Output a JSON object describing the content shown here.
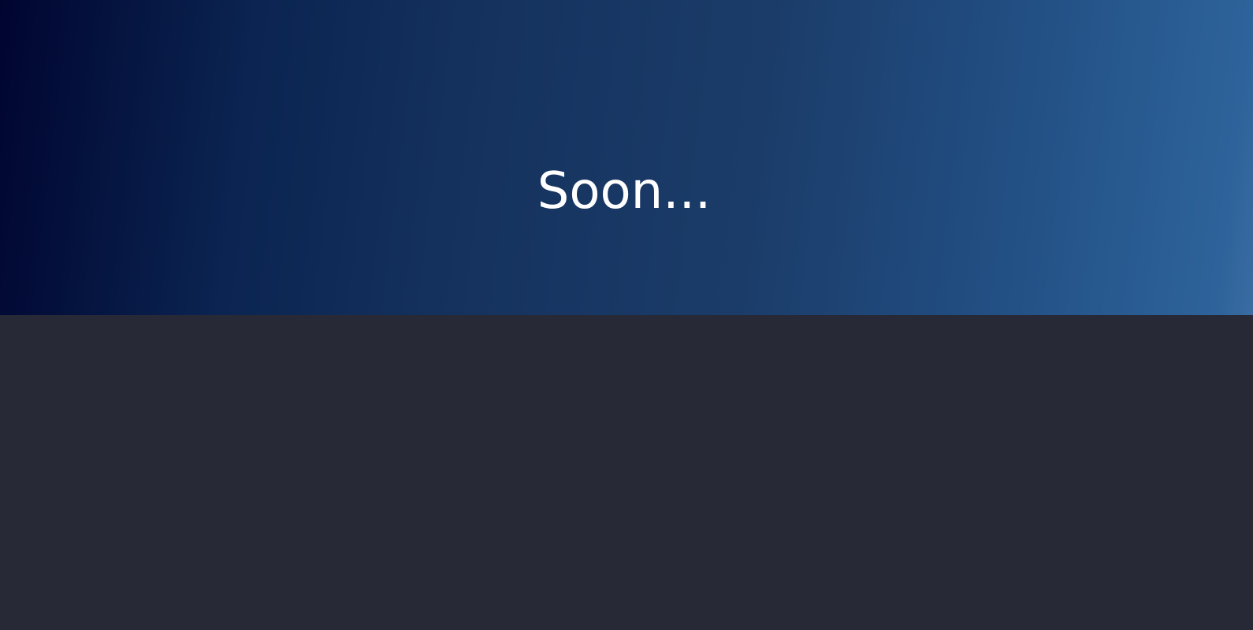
{
  "hero": {
    "title": "Soon..."
  },
  "colors": {
    "gradient_start": "#000530",
    "gradient_end": "#2d639a",
    "lower_background": "#272a36",
    "title_text": "#ffffff"
  }
}
